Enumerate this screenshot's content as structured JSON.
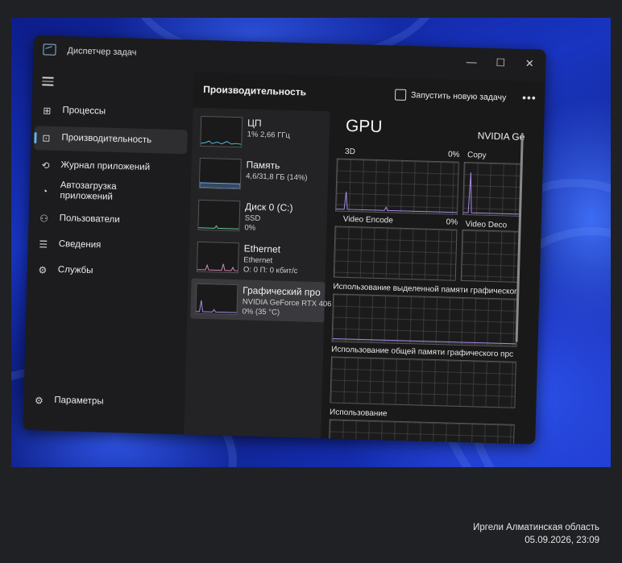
{
  "window": {
    "title": "Диспетчер задач",
    "controls": {
      "minimize": "—",
      "maximize": "☐",
      "close": "✕"
    }
  },
  "sidebar": {
    "items": [
      {
        "label": "Процессы",
        "icon": "processes-icon",
        "glyph": "⊞"
      },
      {
        "label": "Производительность",
        "icon": "performance-icon",
        "glyph": "⊡",
        "active": true
      },
      {
        "label": "Журнал приложений",
        "icon": "app-history-icon",
        "glyph": "⟲"
      },
      {
        "label": "Автозагрузка приложений",
        "icon": "startup-icon",
        "glyph": "◔"
      },
      {
        "label": "Пользователи",
        "icon": "users-icon",
        "glyph": "⚇"
      },
      {
        "label": "Сведения",
        "icon": "details-icon",
        "glyph": "☰"
      },
      {
        "label": "Службы",
        "icon": "services-icon",
        "glyph": "⚙"
      }
    ],
    "settings": {
      "label": "Параметры",
      "icon": "settings-icon",
      "glyph": "⚙"
    }
  },
  "header": {
    "title": "Производительность",
    "run_task_label": "Запустить новую задачу",
    "more": "•••"
  },
  "resources": [
    {
      "title": "ЦП",
      "sub1": "1% 2,66 ГГц",
      "sub2": "",
      "color": "#4fb7d6"
    },
    {
      "title": "Память",
      "sub1": "4,6/31,8 ГБ (14%)",
      "sub2": "",
      "color": "#6aa2e8"
    },
    {
      "title": "Диск 0 (C:)",
      "sub1": "SSD",
      "sub2": "0%",
      "color": "#6dc9a0"
    },
    {
      "title": "Ethernet",
      "sub1": "Ethernet",
      "sub2": "О: 0 П: 0 кбит/с",
      "color": "#d088b0"
    },
    {
      "title": "Графический про",
      "sub1": "NVIDIA GeForce RTX 406",
      "sub2": "0% (35 °C)",
      "color": "#a98be6",
      "active": true
    }
  ],
  "gpu": {
    "title": "GPU",
    "name": "NVIDIA Ge",
    "graphs": {
      "3d": {
        "label": "3D",
        "value": "0%"
      },
      "copy": {
        "label": "Copy"
      },
      "video_encode": {
        "label": "Video Encode",
        "value": "0%"
      },
      "video_decode": {
        "label": "Video Deco"
      },
      "dedicated_memory": {
        "label": "Использование выделенной памяти графическог"
      },
      "shared_memory": {
        "label": "Использование общей памяти графического прс"
      },
      "usage": {
        "label": "Использование"
      }
    }
  },
  "photo_caption": {
    "location": "Иргели Алматинская область",
    "datetime": "05.09.2026, 23:09"
  }
}
